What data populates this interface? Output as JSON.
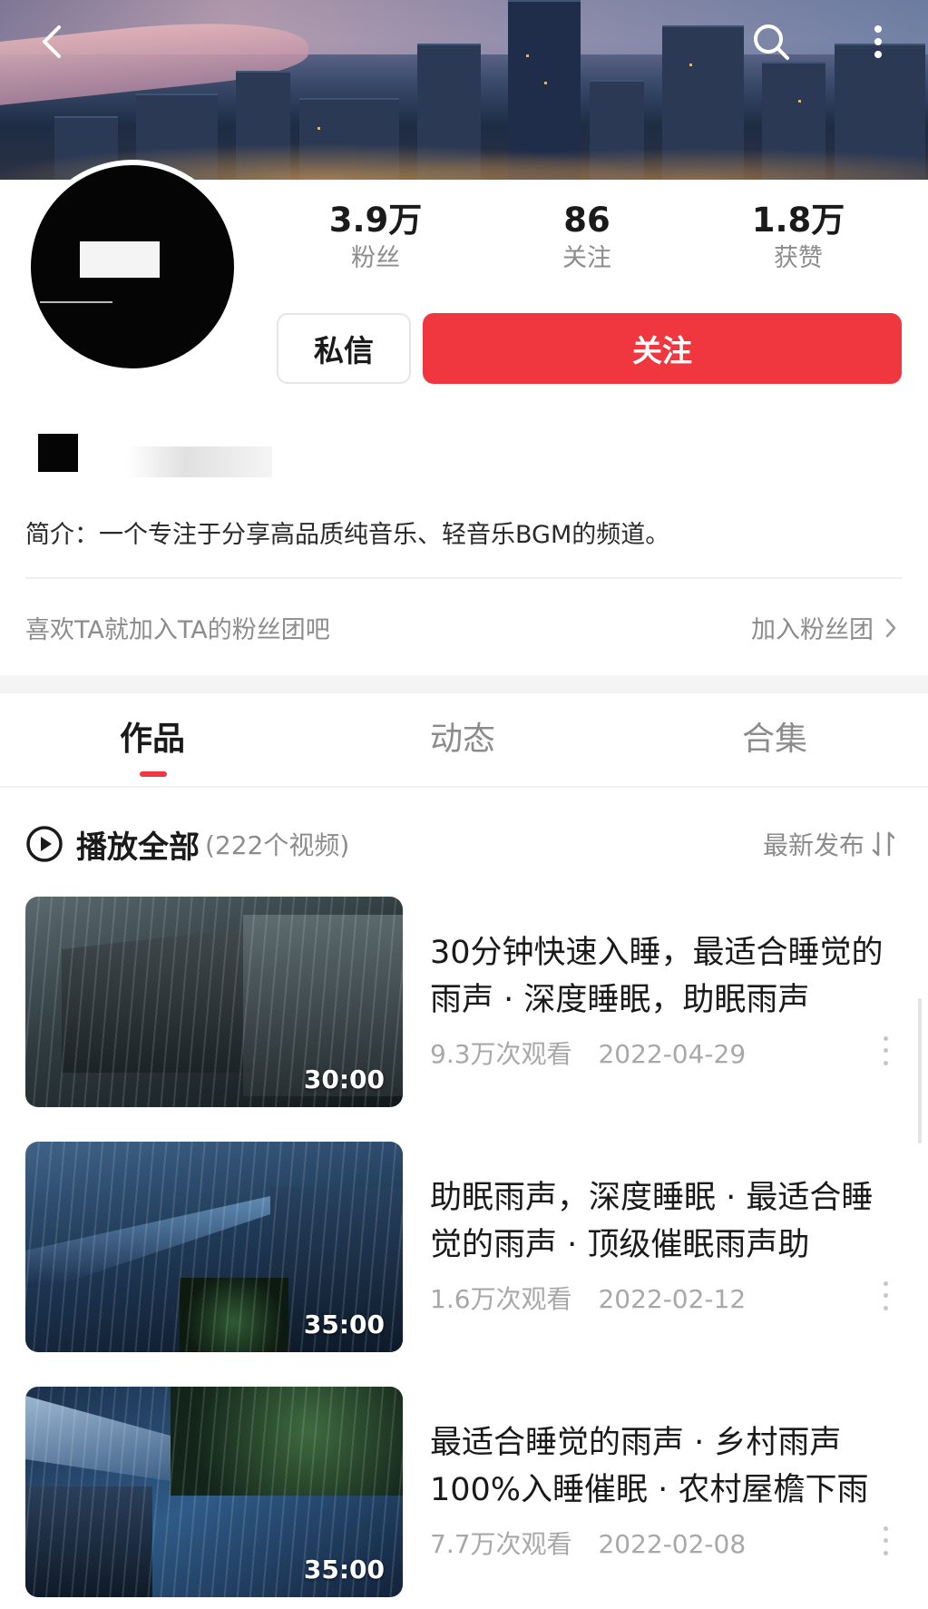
{
  "stats": [
    {
      "value": "3.9万",
      "label": "粉丝"
    },
    {
      "value": "86",
      "label": "关注"
    },
    {
      "value": "1.8万",
      "label": "获赞"
    }
  ],
  "buttons": {
    "message": "私信",
    "follow": "关注"
  },
  "bio": "简介：一个专注于分享高品质纯音乐、轻音乐BGM的频道。",
  "fan_club": {
    "prompt": "喜欢TA就加入TA的粉丝团吧",
    "action": "加入粉丝团"
  },
  "tabs": [
    {
      "label": "作品",
      "active": true
    },
    {
      "label": "动态",
      "active": false
    },
    {
      "label": "合集",
      "active": false
    }
  ],
  "play_all": {
    "label": "播放全部",
    "count": "(222个视频)"
  },
  "sort": {
    "label": "最新发布"
  },
  "videos": [
    {
      "title": "30分钟快速入睡，最适合睡觉的雨声 · 深度睡眠，助眠雨声",
      "views": "9.3万次观看",
      "date": "2022-04-29",
      "duration": "30:00"
    },
    {
      "title": "助眠雨声，深度睡眠 · 最适合睡觉的雨声 · 顶级催眠雨声助",
      "views": "1.6万次观看",
      "date": "2022-02-12",
      "duration": "35:00"
    },
    {
      "title": "最适合睡觉的雨声 · 乡村雨声100%入睡催眠 · 农村屋檐下雨",
      "views": "7.7万次观看",
      "date": "2022-02-08",
      "duration": "35:00"
    }
  ],
  "colors": {
    "accent": "#f0373f",
    "muted_text": "#8c8c8c"
  }
}
